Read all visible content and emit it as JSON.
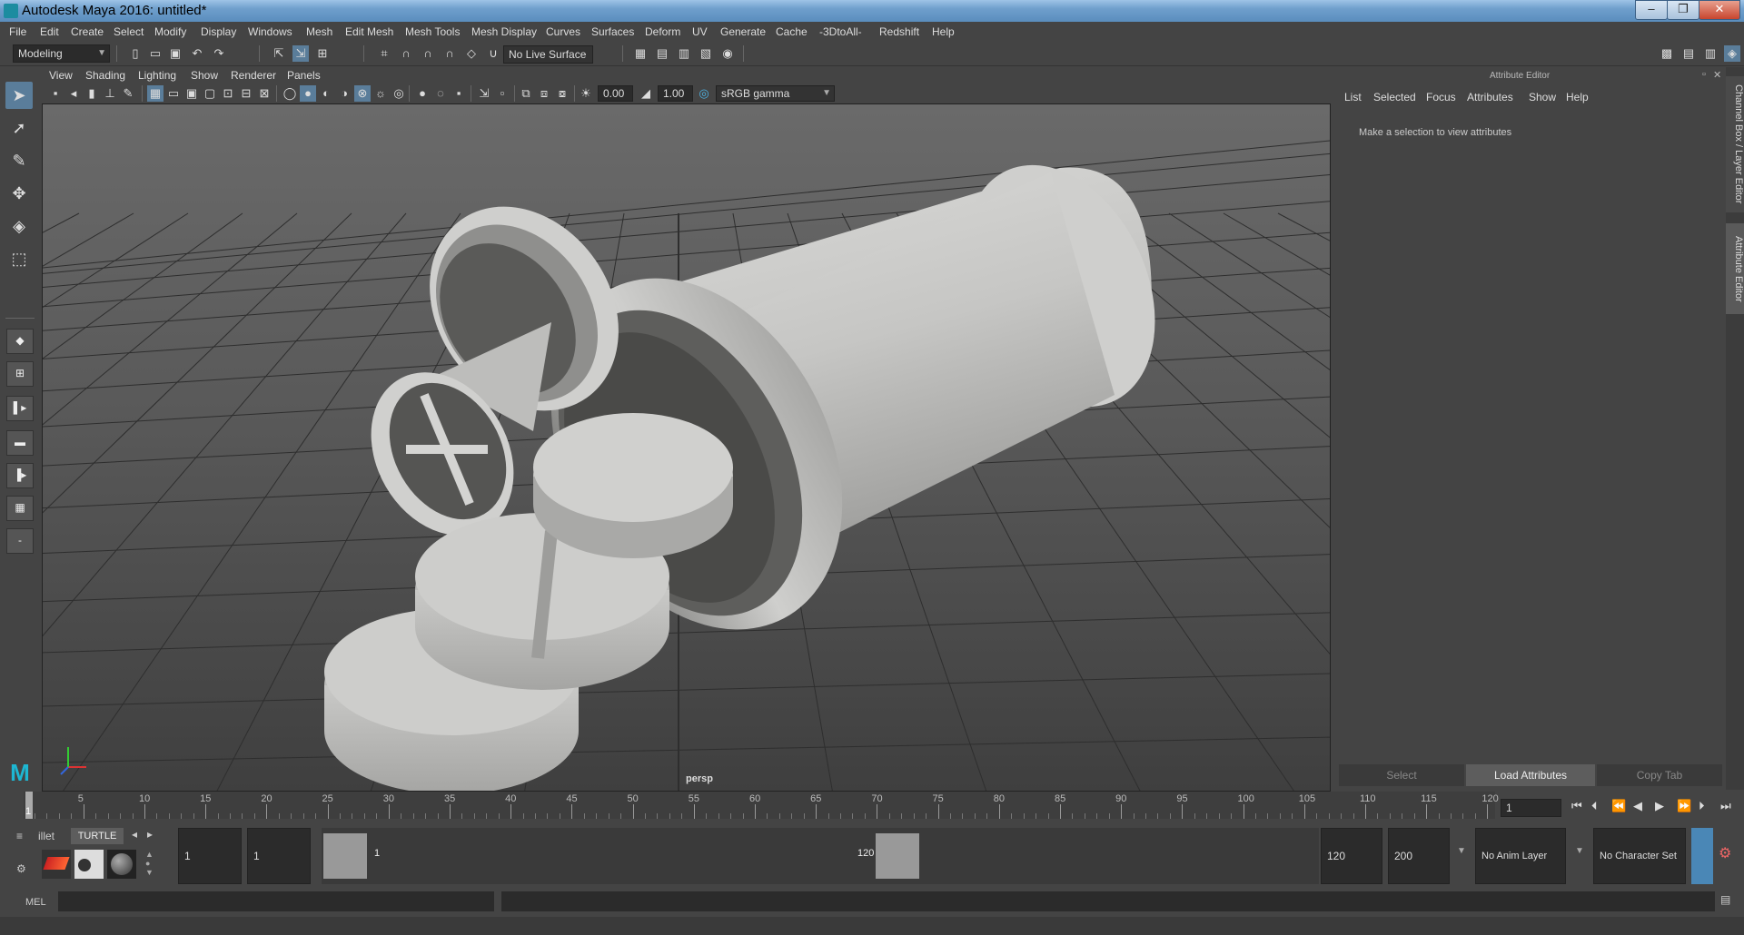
{
  "window": {
    "title": "Autodesk Maya 2016: untitled*"
  },
  "menus": [
    "File",
    "Edit",
    "Create",
    "Select",
    "Modify",
    "Display",
    "Windows",
    "Mesh",
    "Edit Mesh",
    "Mesh Tools",
    "Mesh Display",
    "Curves",
    "Surfaces",
    "Deform",
    "UV",
    "Generate",
    "Cache",
    "-3DtoAll-",
    "Redshift",
    "Help"
  ],
  "status": {
    "mode": "Modeling",
    "live_surface": "No Live Surface"
  },
  "viewport": {
    "menus": [
      "View",
      "Shading",
      "Lighting",
      "Show",
      "Renderer",
      "Panels"
    ],
    "exposure": "0.00",
    "gamma": "1.00",
    "colorspace": "sRGB gamma",
    "camera_label": "persp",
    "colors": {
      "bg_top": "#6a6a6a",
      "bg_bottom": "#3f3f3f",
      "grid": "#2e2e2e",
      "model": "#c8c8c6"
    }
  },
  "attribute_editor": {
    "title": "Attribute Editor",
    "tabs": [
      "List",
      "Selected",
      "Focus",
      "Attributes",
      "Show",
      "Help"
    ],
    "message": "Make a selection to view attributes",
    "buttons": {
      "select": "Select",
      "load": "Load Attributes",
      "copy": "Copy Tab"
    }
  },
  "side_tabs": {
    "channel_box": "Channel Box / Layer Editor",
    "attribute_editor": "Attribute Editor"
  },
  "timeline": {
    "ticks": [
      "5",
      "10",
      "15",
      "20",
      "25",
      "30",
      "35",
      "40",
      "45",
      "50",
      "55",
      "60",
      "65",
      "70",
      "75",
      "80",
      "85",
      "90",
      "95",
      "100",
      "105",
      "110",
      "115",
      "120"
    ],
    "start_marker": "1",
    "current_frame": "1"
  },
  "range": {
    "shelf_tabs": [
      "illet",
      "TURTLE"
    ],
    "start": "1",
    "anim_start": "1",
    "slider_start": "1",
    "slider_end": "120",
    "anim_end": "120",
    "end": "200",
    "anim_layer": "No Anim Layer",
    "character_set": "No Character Set"
  },
  "command": {
    "label": "MEL"
  }
}
